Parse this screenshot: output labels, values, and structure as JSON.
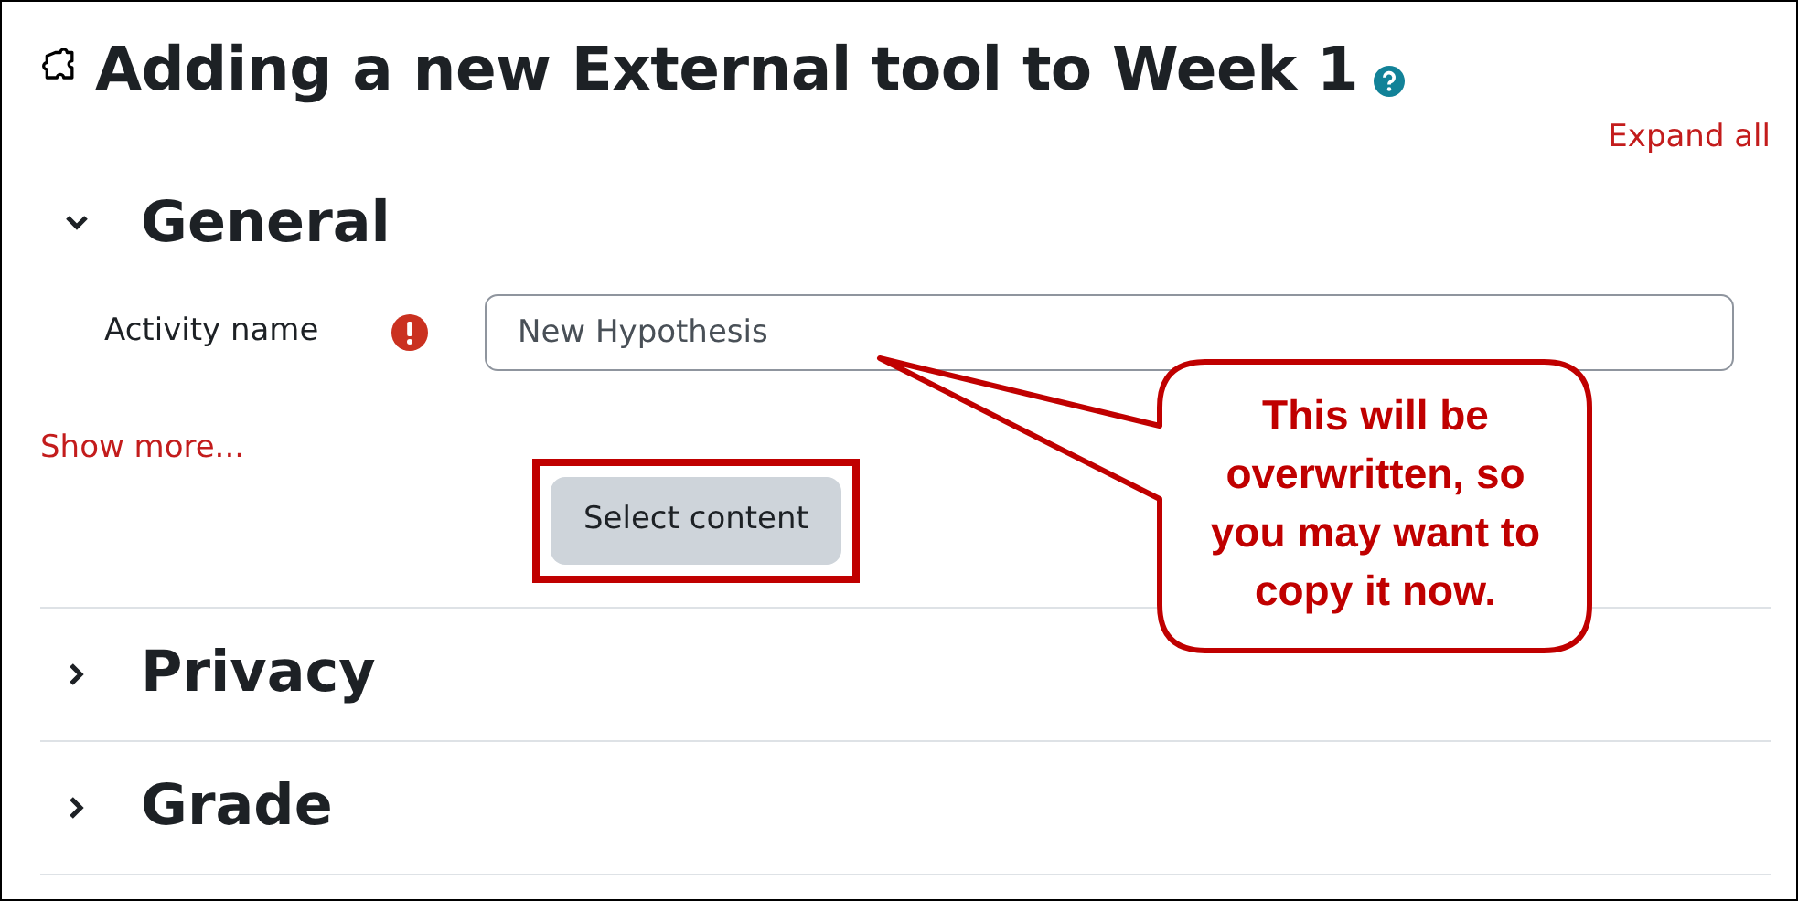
{
  "page": {
    "title": "Adding a new External tool to Week 1",
    "expand_all": "Expand all"
  },
  "sections": [
    {
      "title": "General",
      "expanded": true
    },
    {
      "title": "Privacy",
      "expanded": false
    },
    {
      "title": "Grade",
      "expanded": false
    }
  ],
  "general": {
    "field_label": "Activity name",
    "required": true,
    "value": "New Hypothesis",
    "show_more": "Show more...",
    "button": "Select content",
    "button_highlighted": true
  },
  "callout": {
    "text": "This will be overwritten, so you may want to copy it now."
  }
}
